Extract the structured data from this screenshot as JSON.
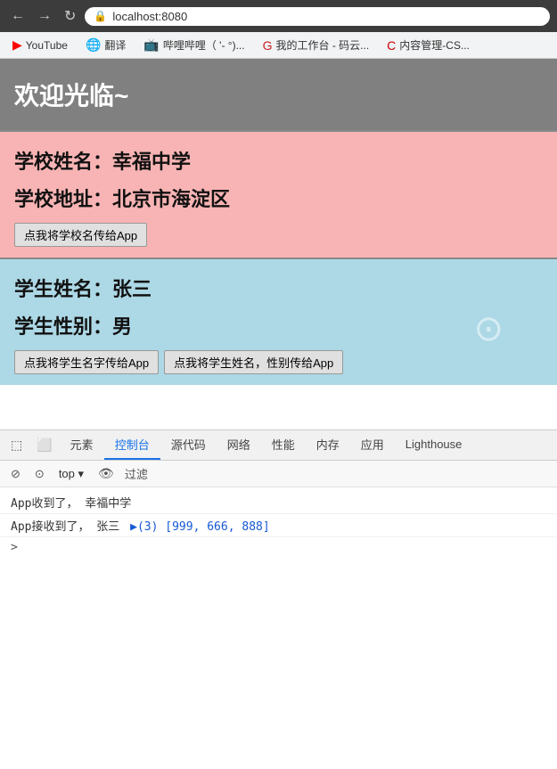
{
  "browser": {
    "url": "localhost:8080",
    "back_label": "←",
    "forward_label": "→",
    "refresh_label": "↻"
  },
  "bookmarks": [
    {
      "label": "YouTube",
      "icon": "▶"
    },
    {
      "label": "翻译",
      "icon": "🌐"
    },
    {
      "label": "哔哩哔哩（ '-  °)..."
    },
    {
      "label": "我的工作台 - 码云..."
    },
    {
      "label": "内容管理-CS..."
    }
  ],
  "page": {
    "welcome": "欢迎光临~",
    "school": {
      "name_label": "学校姓名：幸福中学",
      "addr_label": "学校地址：北京市海淀区",
      "btn_label": "点我将学校名传给App"
    },
    "student": {
      "name_label": "学生姓名：张三",
      "gender_label": "学生性别：男",
      "btn1_label": "点我将学生名字传给App",
      "btn2_label": "点我将学生姓名，性别传给App"
    }
  },
  "devtools": {
    "tabs": [
      "元素",
      "控制台",
      "源代码",
      "网络",
      "性能",
      "内存",
      "应用",
      "Lighthouse"
    ],
    "active_tab": "控制台",
    "filter_placeholder": "过滤",
    "console_lines": [
      {
        "text": "App收到了，  幸福中学"
      },
      {
        "text_parts": [
          "App接收到了，  张三",
          " ▶(3) [999, 666, 888]"
        ]
      }
    ],
    "prompt": ">"
  }
}
